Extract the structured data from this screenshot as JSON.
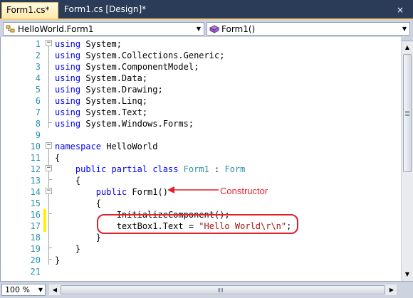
{
  "tabs": [
    {
      "label": "Form1.cs*",
      "active": true
    },
    {
      "label": "Form1.cs [Design]*",
      "active": false
    }
  ],
  "close_glyph": "×",
  "navbar": {
    "type_selector": {
      "value": "HelloWorld.Form1",
      "icon": "class-icon"
    },
    "member_selector": {
      "value": "Form1()",
      "icon": "method-icon"
    }
  },
  "code_lines": [
    {
      "num": "1",
      "tokens": [
        {
          "t": "using",
          "c": "kw"
        },
        {
          "t": " System;",
          "c": "tx"
        }
      ]
    },
    {
      "num": "2",
      "tokens": [
        {
          "t": "using",
          "c": "kw"
        },
        {
          "t": " System.Collections.Generic;",
          "c": "tx"
        }
      ]
    },
    {
      "num": "3",
      "tokens": [
        {
          "t": "using",
          "c": "kw"
        },
        {
          "t": " System.ComponentModel;",
          "c": "tx"
        }
      ]
    },
    {
      "num": "4",
      "tokens": [
        {
          "t": "using",
          "c": "kw"
        },
        {
          "t": " System.Data;",
          "c": "tx"
        }
      ]
    },
    {
      "num": "5",
      "tokens": [
        {
          "t": "using",
          "c": "kw"
        },
        {
          "t": " System.Drawing;",
          "c": "tx"
        }
      ]
    },
    {
      "num": "6",
      "tokens": [
        {
          "t": "using",
          "c": "kw"
        },
        {
          "t": " System.Linq;",
          "c": "tx"
        }
      ]
    },
    {
      "num": "7",
      "tokens": [
        {
          "t": "using",
          "c": "kw"
        },
        {
          "t": " System.Text;",
          "c": "tx"
        }
      ]
    },
    {
      "num": "8",
      "tokens": [
        {
          "t": "using",
          "c": "kw"
        },
        {
          "t": " System.Windows.Forms;",
          "c": "tx"
        }
      ]
    },
    {
      "num": "9",
      "tokens": []
    },
    {
      "num": "10",
      "tokens": [
        {
          "t": "namespace",
          "c": "kw"
        },
        {
          "t": " HelloWorld",
          "c": "tx"
        }
      ]
    },
    {
      "num": "11",
      "tokens": [
        {
          "t": "{",
          "c": "tx"
        }
      ]
    },
    {
      "num": "12",
      "tokens": [
        {
          "t": "    ",
          "c": "tx"
        },
        {
          "t": "public",
          "c": "kw"
        },
        {
          "t": " ",
          "c": "tx"
        },
        {
          "t": "partial",
          "c": "kw"
        },
        {
          "t": " ",
          "c": "tx"
        },
        {
          "t": "class",
          "c": "kw"
        },
        {
          "t": " ",
          "c": "tx"
        },
        {
          "t": "Form1",
          "c": "ty"
        },
        {
          "t": " : ",
          "c": "tx"
        },
        {
          "t": "Form",
          "c": "ty"
        }
      ]
    },
    {
      "num": "13",
      "tokens": [
        {
          "t": "    {",
          "c": "tx"
        }
      ]
    },
    {
      "num": "14",
      "tokens": [
        {
          "t": "        ",
          "c": "tx"
        },
        {
          "t": "public",
          "c": "kw"
        },
        {
          "t": " Form1()",
          "c": "tx"
        }
      ]
    },
    {
      "num": "15",
      "tokens": [
        {
          "t": "        {",
          "c": "tx"
        }
      ]
    },
    {
      "num": "16",
      "tokens": [
        {
          "t": "            InitializeComponent();",
          "c": "tx"
        }
      ],
      "changed": true
    },
    {
      "num": "17",
      "tokens": [
        {
          "t": "            textBox1.Text = ",
          "c": "tx"
        },
        {
          "t": "\"Hello World\\r\\n\"",
          "c": "st"
        },
        {
          "t": ";",
          "c": "tx"
        }
      ],
      "changed": true
    },
    {
      "num": "18",
      "tokens": [
        {
          "t": "        }",
          "c": "tx"
        }
      ]
    },
    {
      "num": "19",
      "tokens": [
        {
          "t": "    }",
          "c": "tx"
        }
      ]
    },
    {
      "num": "20",
      "tokens": [
        {
          "t": "}",
          "c": "tx"
        }
      ]
    },
    {
      "num": "21",
      "tokens": []
    }
  ],
  "annotation": {
    "label": "Constructor",
    "color": "#e0202b"
  },
  "zoom": {
    "value": "100 %"
  },
  "colors": {
    "keyword": "#0000ff",
    "type": "#2b91af",
    "string": "#a31515",
    "line_number": "#2b91af",
    "change_bar": "#fff100",
    "tab_strip": "#2b3c59"
  }
}
